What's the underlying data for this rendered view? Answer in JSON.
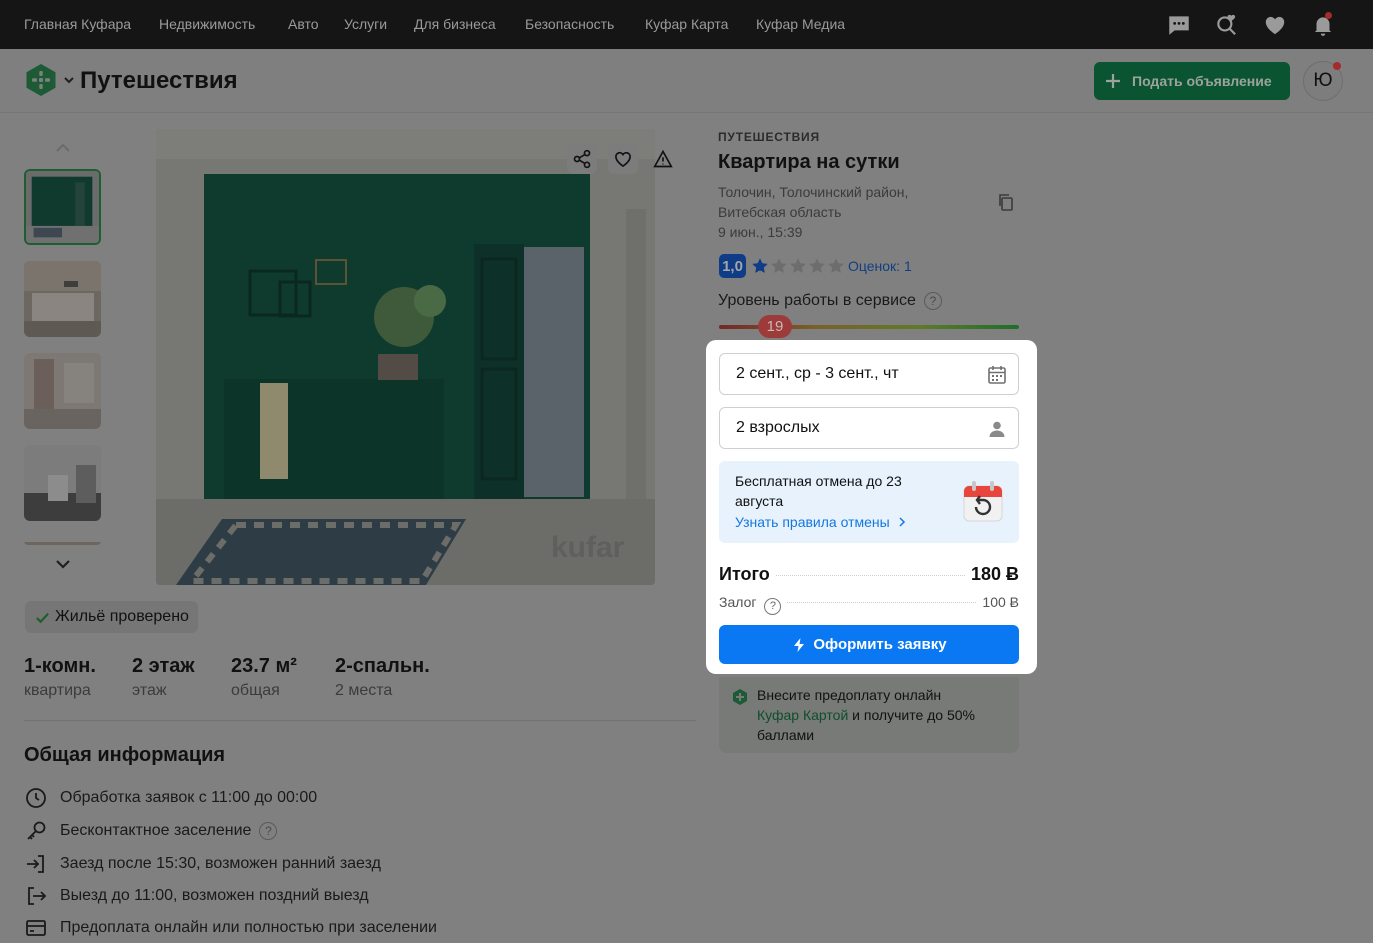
{
  "topnav": {
    "links": [
      "Главная Куфара",
      "Недвижимость",
      "Авто",
      "Услуги",
      "Для бизнеса",
      "Безопасность",
      "Куфар Карта",
      "Куфар Медиа"
    ],
    "icons": [
      "messages-icon",
      "search-heart-icon",
      "heart-icon",
      "bell-icon"
    ]
  },
  "header": {
    "title": "Путешествия",
    "post_button": "Подать объявление",
    "avatar_letter": "Ю"
  },
  "gallery": {
    "thumbnail_count": 5,
    "active_index": 0
  },
  "verified_label": "Жильё проверено",
  "stats": [
    {
      "value": "1-комн.",
      "label": "квартира"
    },
    {
      "value": "2 этаж",
      "label": "этаж"
    },
    {
      "value": "23.7 м²",
      "label": "общая"
    },
    {
      "value": "2-спальн.",
      "label": "2 места"
    }
  ],
  "general_info": {
    "title": "Общая информация",
    "rows": [
      {
        "icon": "clock-icon",
        "text": "Обработка заявок с 11:00 до 00:00"
      },
      {
        "icon": "key-icon",
        "text": "Бесконтактное заселение"
      },
      {
        "icon": "sign-in-icon",
        "text": "Заезд после 15:30, возможен ранний заезд"
      },
      {
        "icon": "sign-out-icon",
        "text": "Выезд до 11:00, возможен поздний выезд"
      },
      {
        "icon": "card-icon",
        "text": "Предоплата онлайн или полностью при заселении"
      }
    ]
  },
  "listing": {
    "category": "ПУТЕШЕСТВИЯ",
    "title": "Квартира на сутки",
    "address_line1": "Толочин, Толочинский район,",
    "address_line2": "Витебская область",
    "date": "9 июн., 15:39",
    "rating": "1,0",
    "ratings_link": "Оценок: 1",
    "stars_filled": 1,
    "stars_total": 5,
    "service_level_label": "Уровень работы в сервисе",
    "service_level_value": "19"
  },
  "booking": {
    "dates": "2 сент., ср - 3 сент., чт",
    "guests": "2 взрослых",
    "cancel_text": "Бесплатная отмена до 23 августа",
    "cancel_link": "Узнать правила отмены",
    "total_label": "Итого",
    "total_value": "180 Ƀ",
    "deposit_label": "Залог",
    "deposit_value": "100 Ƀ",
    "submit": "Оформить заявку"
  },
  "promo": {
    "text_before": "Внесите предоплату онлайн",
    "link": "Куфар Картой",
    "text_after": "и получите до 50% баллами"
  },
  "colors": {
    "brand_green": "#0a5431",
    "primary_blue": "#0a78f2",
    "overlay_bg": "#808080"
  }
}
